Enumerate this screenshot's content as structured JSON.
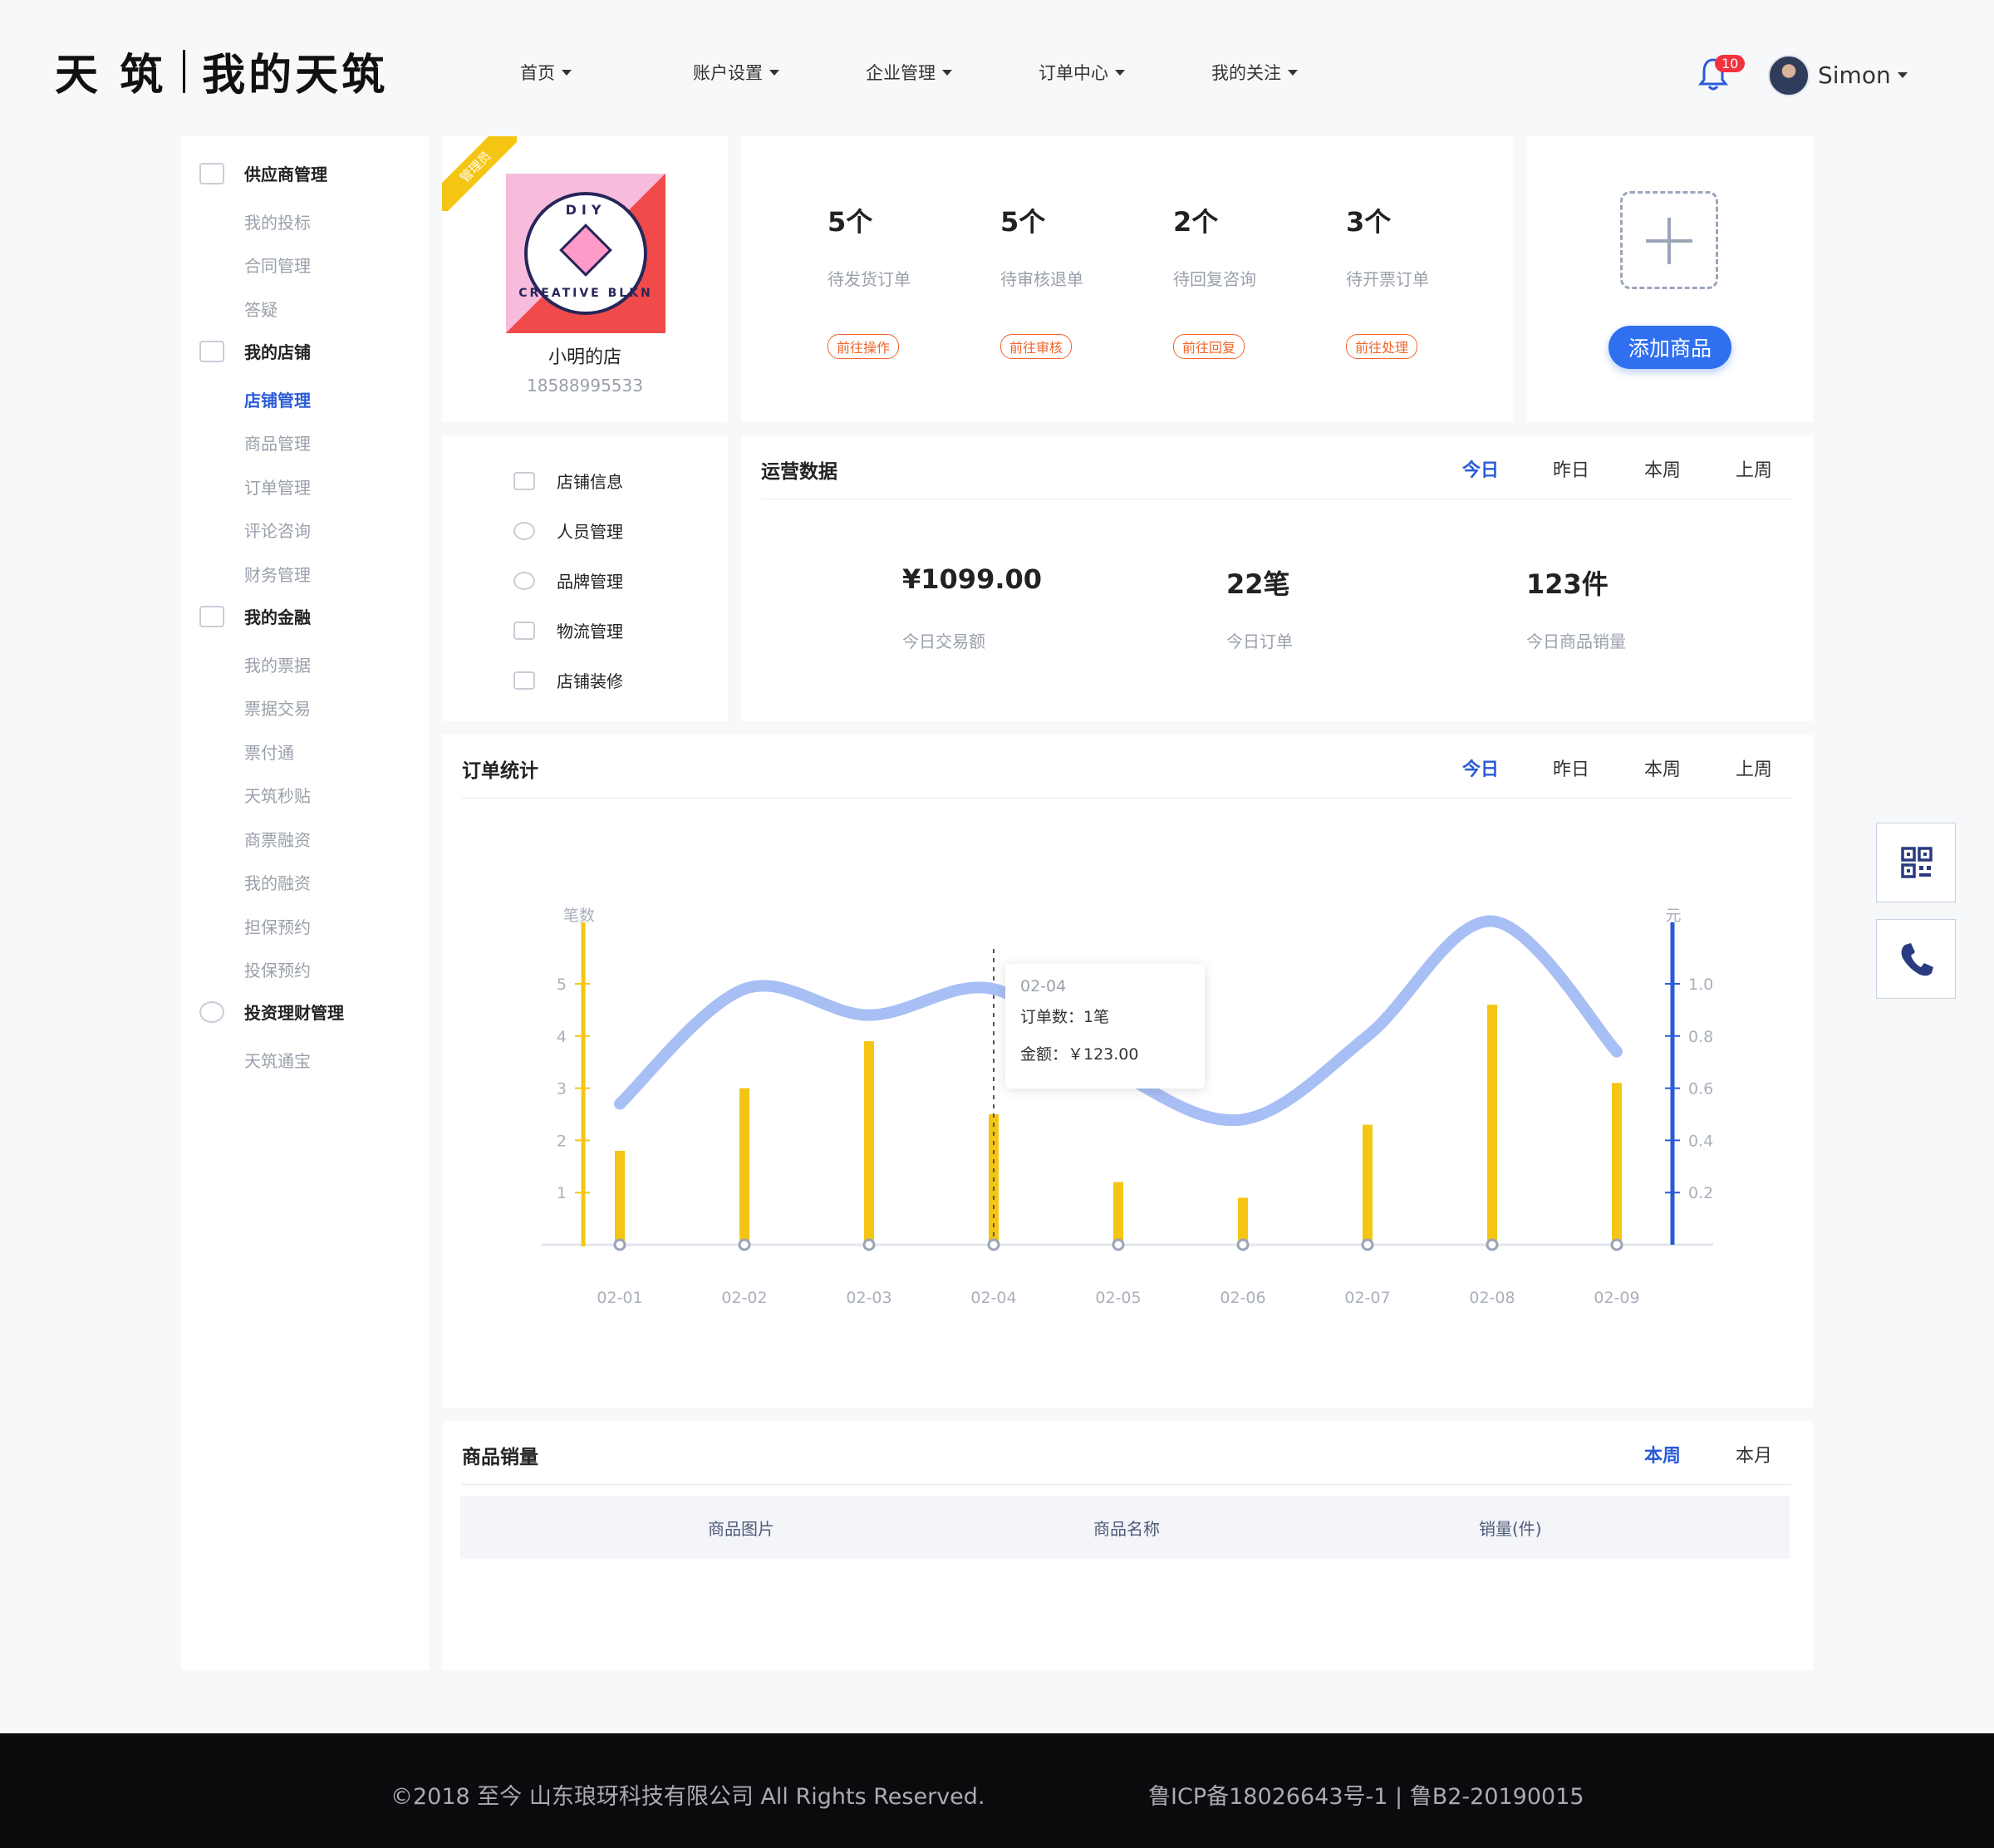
{
  "header": {
    "logo_left": "天 筑",
    "logo_right": "我的天筑",
    "nav": [
      "首页",
      "账户设置",
      "企业管理",
      "订单中心",
      "我的关注"
    ],
    "notif_count": "10",
    "username": "Simon"
  },
  "sidebar": {
    "groups": [
      {
        "label": "供应商管理",
        "icon": "supplier-icon"
      },
      {
        "label": "我的店铺",
        "icon": "store-icon"
      },
      {
        "label": "我的金融",
        "icon": "yuan-icon"
      },
      {
        "label": "投资理财管理",
        "icon": "invest-icon"
      }
    ],
    "items": [
      "我的投标",
      "合同管理",
      "答疑",
      "店铺管理",
      "商品管理",
      "订单管理",
      "评论咨询",
      "财务管理",
      "我的票据",
      "票据交易",
      "票付通",
      "天筑秒贴",
      "商票融资",
      "我的融资",
      "担保预约",
      "投保预约",
      "天筑通宝"
    ],
    "active_item": "店铺管理"
  },
  "shop": {
    "ribbon": "管理员",
    "logo_top": "DIY",
    "logo_bottom": "CREATIVE BLKN",
    "name": "小明的店",
    "phone": "18588995533"
  },
  "stats": [
    {
      "num": "5个",
      "label": "待发货订单",
      "btn": "前往操作"
    },
    {
      "num": "5个",
      "label": "待审核退单",
      "btn": "前往审核"
    },
    {
      "num": "2个",
      "label": "待回复咨询",
      "btn": "前往回复"
    },
    {
      "num": "3个",
      "label": "待开票订单",
      "btn": "前往处理"
    }
  ],
  "add_product": "添加商品",
  "shop_menu": [
    {
      "label": "店铺信息",
      "icon": "store-icon"
    },
    {
      "label": "人员管理",
      "icon": "person-icon"
    },
    {
      "label": "品牌管理",
      "icon": "registered-icon"
    },
    {
      "label": "物流管理",
      "icon": "truck-icon"
    },
    {
      "label": "店铺装修",
      "icon": "brush-icon"
    }
  ],
  "ops": {
    "title": "运营数据",
    "tabs": [
      "今日",
      "昨日",
      "本周",
      "上周"
    ],
    "active_tab": "今日",
    "metrics": [
      {
        "value": "¥1099.00",
        "label": "今日交易额"
      },
      {
        "value": "22笔",
        "label": "今日订单"
      },
      {
        "value": "123件",
        "label": "今日商品销量"
      }
    ]
  },
  "order_stats": {
    "title": "订单统计",
    "tabs": [
      "今日",
      "昨日",
      "本周",
      "上周"
    ],
    "active_tab": "今日",
    "tooltip": {
      "date": "02-04",
      "line1": "订单数：1笔",
      "line2": "金额：￥123.00"
    }
  },
  "chart_data": {
    "type": "bar",
    "categories": [
      "02-01",
      "02-02",
      "02-03",
      "02-04",
      "02-05",
      "02-06",
      "02-07",
      "02-08",
      "02-09"
    ],
    "ylabel_left": "笔数",
    "ylabel_right": "元",
    "yticks_left": [
      "1",
      "2",
      "3",
      "4",
      "5"
    ],
    "yticks_right": [
      "0.2",
      "0.4",
      "0.6",
      "0.8",
      "1.0"
    ],
    "ylim_left": [
      0,
      5.7
    ],
    "ylim_right": [
      0,
      1.14
    ],
    "grid": false,
    "series": [
      {
        "type": "bar",
        "values": [
          1.8,
          3.0,
          3.9,
          2.5,
          1.2,
          0.9,
          2.3,
          4.6,
          3.1
        ],
        "color": "#f5c514"
      },
      {
        "type": "line",
        "values": [
          0.54,
          0.98,
          0.88,
          0.98,
          0.66,
          0.48,
          0.8,
          1.24,
          0.74
        ],
        "color": "#a8bff5"
      }
    ],
    "highlight": "02-04"
  },
  "sales": {
    "title": "商品销量",
    "tabs": [
      "本周",
      "本月"
    ],
    "active_tab": "本周",
    "columns": [
      "商品图片",
      "商品名称",
      "销量(件)"
    ]
  },
  "footer": {
    "copyright": "©2018 至今 山东琅玡科技有限公司 All Rights Reserved.",
    "icp": "鲁ICP备18026643号-1 | 鲁B2-20190015"
  },
  "colors": {
    "accent": "#2a5bd7",
    "bar": "#f5c514",
    "line": "#a8bff5",
    "warn": "#f0652a"
  }
}
